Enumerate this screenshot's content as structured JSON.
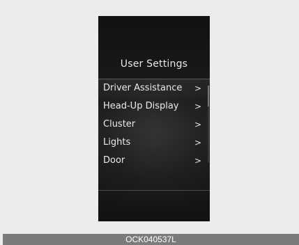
{
  "screen": {
    "title": "User Settings",
    "menu": [
      {
        "label": "Driver Assistance",
        "chevron": ">",
        "selected": true
      },
      {
        "label": "Head-Up Display",
        "chevron": ">"
      },
      {
        "label": "Cluster",
        "chevron": ">"
      },
      {
        "label": "Lights",
        "chevron": ">"
      },
      {
        "label": "Door",
        "chevron": ">"
      }
    ]
  },
  "caption": {
    "code": "OCK040537L"
  }
}
